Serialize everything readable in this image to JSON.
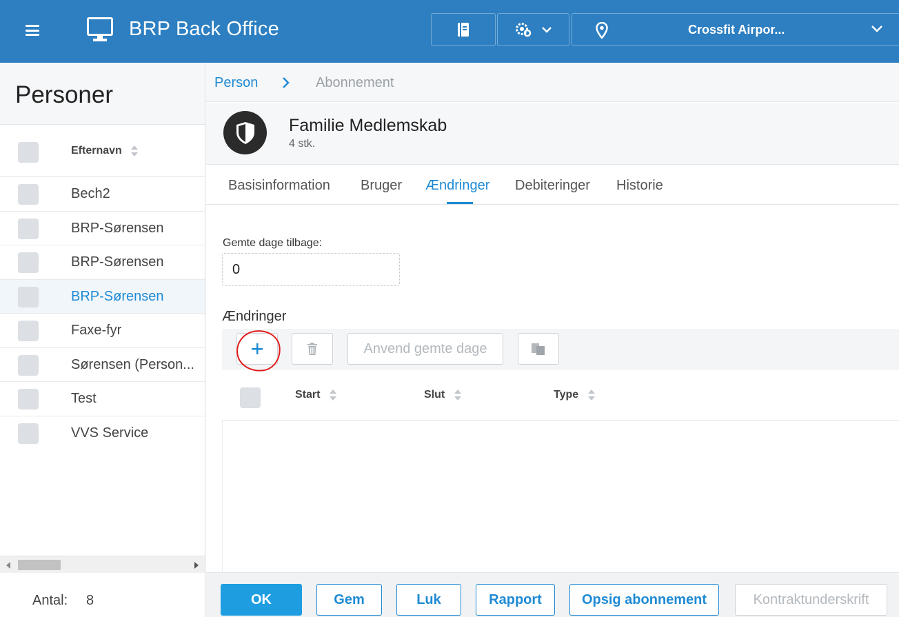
{
  "app": {
    "title": "BRP Back Office"
  },
  "topbar": {
    "location": "Crossfit Airpor..."
  },
  "left": {
    "title": "Personer",
    "column": "Efternavn",
    "rows": [
      {
        "name": "Bech2"
      },
      {
        "name": "BRP-Sørensen"
      },
      {
        "name": "BRP-Sørensen"
      },
      {
        "name": "BRP-Sørensen"
      },
      {
        "name": "Faxe-fyr"
      },
      {
        "name": "Sørensen (Person..."
      },
      {
        "name": "Test"
      },
      {
        "name": "VVS Service"
      }
    ],
    "count_label": "Antal:",
    "count_value": "8"
  },
  "breadcrumb": {
    "root": "Person",
    "current": "Abonnement"
  },
  "subscription": {
    "title": "Familie Medlemskab",
    "subtitle": "4 stk."
  },
  "tabs": [
    "Basisinformation",
    "Bruger",
    "Ændringer",
    "Debiteringer",
    "Historie"
  ],
  "form": {
    "saved_days_label": "Gemte dage tilbage:",
    "saved_days_value": "0",
    "section_title": "Ændringer",
    "apply_button": "Anvend gemte dage"
  },
  "grid": {
    "columns": [
      "Start",
      "Slut",
      "Type"
    ]
  },
  "footer": {
    "ok": "OK",
    "save": "Gem",
    "close": "Luk",
    "report": "Rapport",
    "cancel_sub": "Opsig abonnement",
    "contract_sign": "Kontraktunderskrift"
  },
  "colors": {
    "topbar": "#2d7fc1",
    "accent": "#1e8ad4",
    "primary_button": "#1e9ee0"
  }
}
